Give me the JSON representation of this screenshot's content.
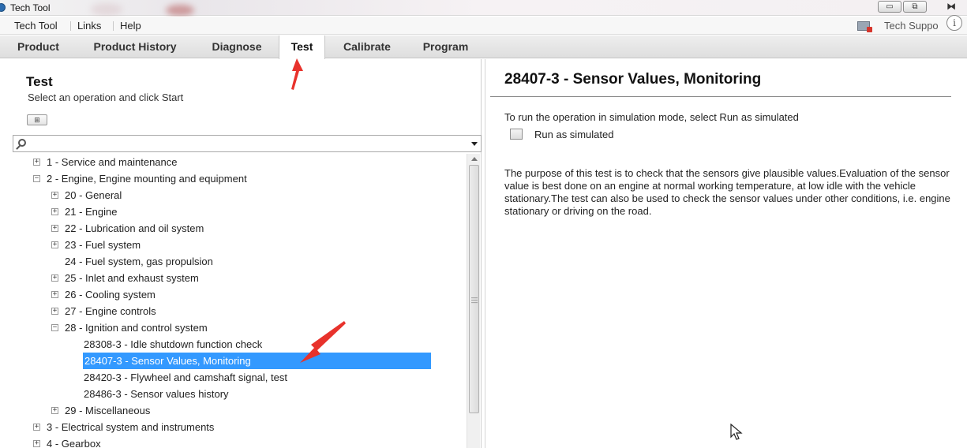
{
  "window": {
    "title": "Tech Tool",
    "buttons": {
      "minimize": "▭",
      "maximize": "⧉",
      "close": "⧓"
    }
  },
  "menubar": {
    "items": [
      "Tech Tool",
      "Links",
      "Help"
    ],
    "tech_support": "Tech Suppo",
    "info": "i"
  },
  "tabs": [
    "Product",
    "Product History",
    "Diagnose",
    "Test",
    "Calibrate",
    "Program"
  ],
  "active_tab": "Test",
  "left": {
    "title": "Test",
    "subtitle": "Select an operation and click Start",
    "expand_all": "⊞",
    "search_value": "",
    "tree": [
      {
        "label": "1 - Service and maintenance",
        "toggle": "+"
      },
      {
        "label": "2 - Engine, Engine mounting and equipment",
        "toggle": "−"
      },
      {
        "label": "20 - General",
        "toggle": "+"
      },
      {
        "label": "21 - Engine",
        "toggle": "+"
      },
      {
        "label": "22 - Lubrication and oil system",
        "toggle": "+"
      },
      {
        "label": "23 - Fuel system",
        "toggle": "+"
      },
      {
        "label": "24 - Fuel system, gas propulsion",
        "toggle": ""
      },
      {
        "label": "25 - Inlet and exhaust system",
        "toggle": "+"
      },
      {
        "label": "26 - Cooling system",
        "toggle": "+"
      },
      {
        "label": "27 - Engine controls",
        "toggle": "+"
      },
      {
        "label": "28 - Ignition and control system",
        "toggle": "−"
      },
      {
        "label": "28308-3 - Idle shutdown function check",
        "toggle": ""
      },
      {
        "label": "28407-3 - Sensor Values, Monitoring",
        "toggle": "",
        "selected": true
      },
      {
        "label": "28420-3 - Flywheel and camshaft signal, test",
        "toggle": ""
      },
      {
        "label": "28486-3 - Sensor values history",
        "toggle": ""
      },
      {
        "label": "29 - Miscellaneous",
        "toggle": "+"
      },
      {
        "label": "3 - Electrical system and instruments",
        "toggle": "+"
      },
      {
        "label": "4 - Gearbox",
        "toggle": "+"
      }
    ]
  },
  "right": {
    "title": "28407-3 - Sensor Values, Monitoring",
    "simulation_hint": "To run the operation in simulation mode, select Run as simulated",
    "run_as_simulated": "Run as simulated",
    "description": "The purpose of this test is to check that the sensors give plausible values.Evaluation of the sensor value is best done on an engine at normal working temperature, at low idle with the vehicle stationary.The test can also be used to check the sensor values under other conditions, i.e. engine stationary or driving on the road."
  },
  "colors": {
    "selection": "#3399ff",
    "annotation_arrow": "#e8322c",
    "tab_bar": "#e4e4e4"
  }
}
